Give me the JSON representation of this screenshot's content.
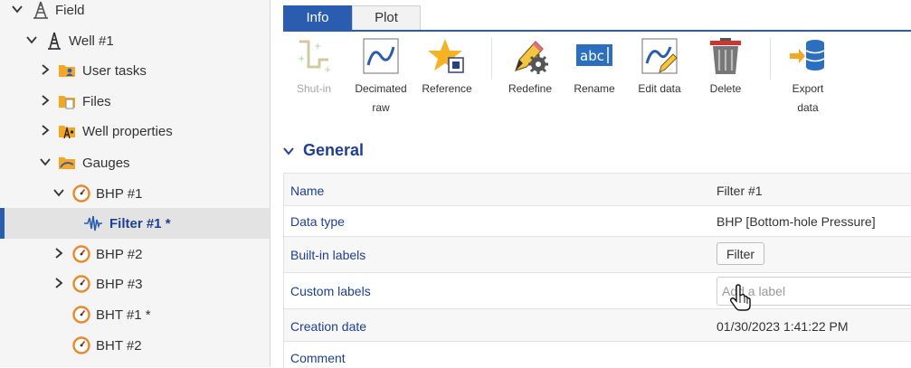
{
  "tree": {
    "items": [
      {
        "label": "Field",
        "icon": "field-derrick-icon",
        "state": "expanded",
        "selected": false
      },
      {
        "label": "Well #1",
        "icon": "well-derrick-icon",
        "state": "expanded",
        "selected": false
      },
      {
        "label": "User tasks",
        "icon": "user-tasks-folder-icon",
        "state": "collapsed",
        "selected": false
      },
      {
        "label": "Files",
        "icon": "files-folder-icon",
        "state": "collapsed",
        "selected": false
      },
      {
        "label": "Well properties",
        "icon": "well-properties-folder-icon",
        "state": "collapsed",
        "selected": false
      },
      {
        "label": "Gauges",
        "icon": "gauges-folder-icon",
        "state": "expanded",
        "selected": false
      },
      {
        "label": "BHP #1",
        "icon": "gauge-icon",
        "state": "expanded",
        "selected": false
      },
      {
        "label": "Filter #1 *",
        "icon": "filter-wave-icon",
        "state": "leaf",
        "selected": true
      },
      {
        "label": "BHP #2",
        "icon": "gauge-icon",
        "state": "collapsed",
        "selected": false
      },
      {
        "label": "BHP #3",
        "icon": "gauge-icon",
        "state": "collapsed",
        "selected": false
      },
      {
        "label": "BHT #1 *",
        "icon": "gauge-icon",
        "state": "leaf",
        "selected": false
      },
      {
        "label": "BHT #2",
        "icon": "gauge-icon",
        "state": "leaf",
        "selected": false
      }
    ]
  },
  "tabs": [
    {
      "label": "Info",
      "active": true
    },
    {
      "label": "Plot",
      "active": false
    }
  ],
  "toolbar": {
    "items": [
      {
        "label": "Shut-in",
        "icon": "shut-in-icon",
        "disabled": true
      },
      {
        "label": "Decimated raw",
        "icon": "decimated-raw-icon",
        "disabled": false
      },
      {
        "label": "Reference",
        "icon": "reference-star-icon",
        "disabled": false
      },
      {
        "label": "Redefine",
        "icon": "redefine-pencil-gear-icon",
        "disabled": false
      },
      {
        "label": "Rename",
        "icon": "rename-abc-icon",
        "disabled": false
      },
      {
        "label": "Edit data",
        "icon": "edit-data-icon",
        "disabled": false
      },
      {
        "label": "Delete",
        "icon": "trash-icon",
        "disabled": false
      },
      {
        "label": "Export data",
        "icon": "export-database-icon",
        "disabled": false
      }
    ]
  },
  "general": {
    "title": "General",
    "rows": {
      "name": {
        "label": "Name",
        "value": "Filter #1"
      },
      "data_type": {
        "label": "Data type",
        "value": "BHP [Bottom-hole Pressure]"
      },
      "builtin_labels": {
        "label": "Built-in labels",
        "button": "Filter"
      },
      "custom_labels": {
        "label": "Custom labels",
        "placeholder": "Add a label"
      },
      "creation_date": {
        "label": "Creation date",
        "value": "01/30/2023 1:41:22 PM"
      },
      "comment": {
        "label": "Comment",
        "value": ""
      }
    }
  },
  "colors": {
    "accent": "#2a5db0",
    "label_blue": "#1f3f8f",
    "gauge_orange": "#e8892a",
    "folder_orange": "#f5a623"
  }
}
